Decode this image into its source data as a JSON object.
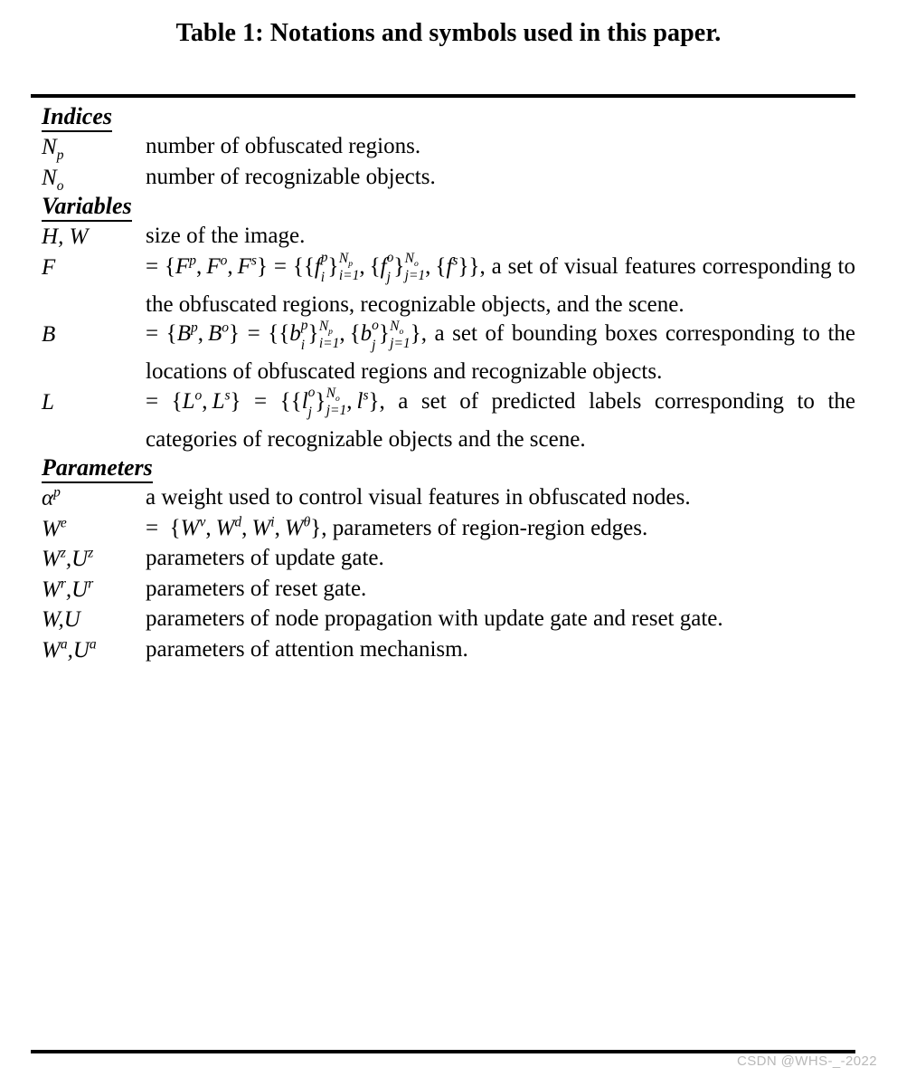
{
  "caption": "Table 1: Notations and symbols used in this paper.",
  "watermark": "CSDN @WHS-_-2022",
  "groups": [
    {
      "heading": "Indices",
      "rows": [
        {
          "symbol": "N_p",
          "symbol_text": "Np",
          "description": "number of obfuscated regions."
        },
        {
          "symbol": "N_o",
          "symbol_text": "No",
          "description": "number of recognizable objects."
        }
      ]
    },
    {
      "heading": "Variables",
      "rows": [
        {
          "symbol": "H, W",
          "symbol_text": "H, W",
          "description": "size of the image."
        },
        {
          "symbol": "F",
          "symbol_text": "F",
          "description": "= {F^p, F^o, F^s} = {{f_i^p}_{i=1}^{N_p}, {f_j^o}_{j=1}^{N_o}, {f^s}}, a set of visual features corresponding to the obfuscated regions, recognizable objects, and the scene."
        },
        {
          "symbol": "B",
          "symbol_text": "B",
          "description": "= {B^p, B^o} = {{b_i^p}_{i=1}^{N_p}, {b_j^o}_{j=1}^{N_o}}, a set of bounding boxes corresponding to the locations of obfuscated regions and recognizable objects."
        },
        {
          "symbol": "L",
          "symbol_text": "L",
          "description": "= {L^o, L^s} = {{l_j^o}_{j=1}^{N_o}, l^s}, a set of predicted labels corresponding to the categories of recognizable objects and the scene."
        }
      ]
    },
    {
      "heading": "Parameters",
      "rows": [
        {
          "symbol": "alpha^p",
          "symbol_text": "αp",
          "description": "a weight used to control visual features in obfuscated nodes."
        },
        {
          "symbol": "W^e",
          "symbol_text": "We",
          "description": "= {W^v, W^d, W^i, W^θ}, parameters of region-region edges."
        },
        {
          "symbol": "W^z, U^z",
          "symbol_text": "Wz, Uz",
          "description": "parameters of update gate."
        },
        {
          "symbol": "W^r, U^r",
          "symbol_text": "Wr, Ur",
          "description": "parameters of reset gate."
        },
        {
          "symbol": "W, U",
          "symbol_text": "W, U",
          "description": "parameters of node propagation with update gate and reset gate."
        },
        {
          "symbol": "W^a, U^a",
          "symbol_text": "Wa, Ua",
          "description": "parameters of attention mechanism."
        }
      ]
    }
  ],
  "text": {
    "np_desc": "number of obfuscated regions.",
    "no_desc": "number of recognizable objects.",
    "hw_desc": "size of the image.",
    "f_tail": ", a set of visual features corresponding to the obfuscated regions, recognizable objects, and the scene.",
    "b_tail": ", a set of bounding boxes corresponding to the locations of obfuscated regions and recognizable objects.",
    "l_tail": ", a set of predicted labels corresponding to the categories of recognizable objects and the scene.",
    "alpha_desc": "a weight used to control visual features in obfuscated nodes.",
    "we_tail": ", parameters of region-region edges.",
    "wz_desc": "parameters of update gate.",
    "wr_desc": "parameters of reset gate.",
    "wu_desc": "parameters of node propagation with update gate and reset gate.",
    "wa_desc": "parameters of attention mechanism.",
    "heading_indices": "Indices",
    "heading_variables": "Variables",
    "heading_parameters": "Parameters"
  }
}
